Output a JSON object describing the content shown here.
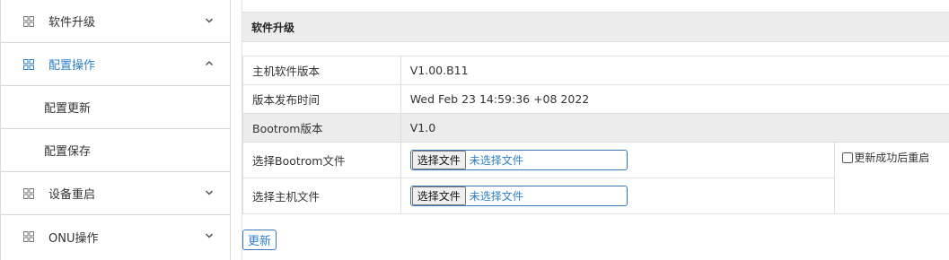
{
  "sidebar": {
    "items": [
      {
        "label": "软件升级",
        "icon": "grid-icon",
        "chevron": "chevron-down-icon"
      },
      {
        "label": "配置操作",
        "icon": "grid-icon",
        "chevron": "chevron-up-icon",
        "active": true
      },
      {
        "label": "配置更新"
      },
      {
        "label": "配置保存"
      },
      {
        "label": "设备重启",
        "icon": "grid-icon",
        "chevron": "chevron-down-icon"
      },
      {
        "label": "ONU操作",
        "icon": "grid-icon",
        "chevron": "chevron-down-icon"
      }
    ]
  },
  "main": {
    "section_title": "软件升级",
    "rows": [
      {
        "label": "主机软件版本",
        "value": "V1.00.B11"
      },
      {
        "label": "版本发布时间",
        "value": "Wed Feb 23 14:59:36 +08 2022"
      },
      {
        "label": "Bootrom版本",
        "value": "V1.0"
      },
      {
        "label": "选择Bootrom文件",
        "button": "选择文件",
        "file": "未选择文件"
      },
      {
        "label": "选择主机文件",
        "button": "选择文件",
        "file": "未选择文件"
      }
    ],
    "reboot_checkbox_label": "更新成功后重启",
    "update_button": "更新"
  },
  "colors": {
    "accent": "#2e80c9",
    "header_bg": "#ececec",
    "border": "#d9d9d9"
  }
}
